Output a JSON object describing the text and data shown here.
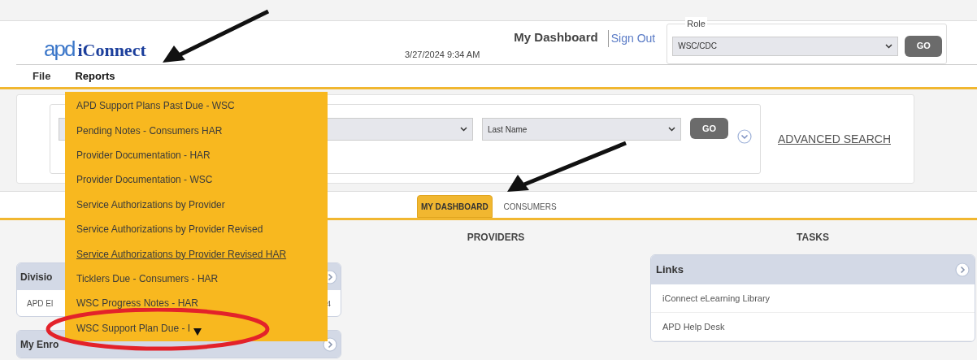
{
  "header": {
    "logo_mark": "apd",
    "logo_text": "iConnect",
    "datetime": "3/27/2024 9:34 AM",
    "page_title": "My Dashboard",
    "sign_out": "Sign Out",
    "role": {
      "label": "Role",
      "value": "WSC/CDC",
      "go": "GO"
    }
  },
  "menubar": [
    {
      "label": "File",
      "expanded": false
    },
    {
      "label": "Reports",
      "expanded": true
    }
  ],
  "reports_menu": [
    {
      "label": "APD Support Plans Past Due - WSC",
      "hovered": false
    },
    {
      "label": "Pending Notes - Consumers HAR",
      "hovered": false
    },
    {
      "label": "Provider Documentation - HAR",
      "hovered": false
    },
    {
      "label": "Provider Documentation - WSC",
      "hovered": false
    },
    {
      "label": "Service Authorizations by Provider",
      "hovered": false
    },
    {
      "label": "Service Authorizations by Provider Revised",
      "hovered": false
    },
    {
      "label": "Service Authorizations by Provider Revised HAR",
      "hovered": true
    },
    {
      "label": "Ticklers Due - Consumers - HAR",
      "hovered": false
    },
    {
      "label": "WSC Progress Notes - HAR",
      "hovered": false
    },
    {
      "label": "WSC Support Plan Due - I",
      "hovered": false
    }
  ],
  "search": {
    "sort_select": "Last Name",
    "go": "GO",
    "advanced_search": "ADVANCED SEARCH"
  },
  "tabs": [
    {
      "label": "MY DASHBOARD",
      "selected": true
    },
    {
      "label": "CONSUMERS",
      "selected": false
    }
  ],
  "columns": [
    "PROVIDERS",
    "TASKS"
  ],
  "left_panels": [
    {
      "title": "Divisio",
      "rows": [
        {
          "label": "APD El",
          "count": "4"
        }
      ]
    },
    {
      "title": "My Enro"
    }
  ],
  "links_panel": {
    "title": "Links",
    "items": [
      "iConnect eLearning Library",
      "APD Help Desk"
    ]
  }
}
